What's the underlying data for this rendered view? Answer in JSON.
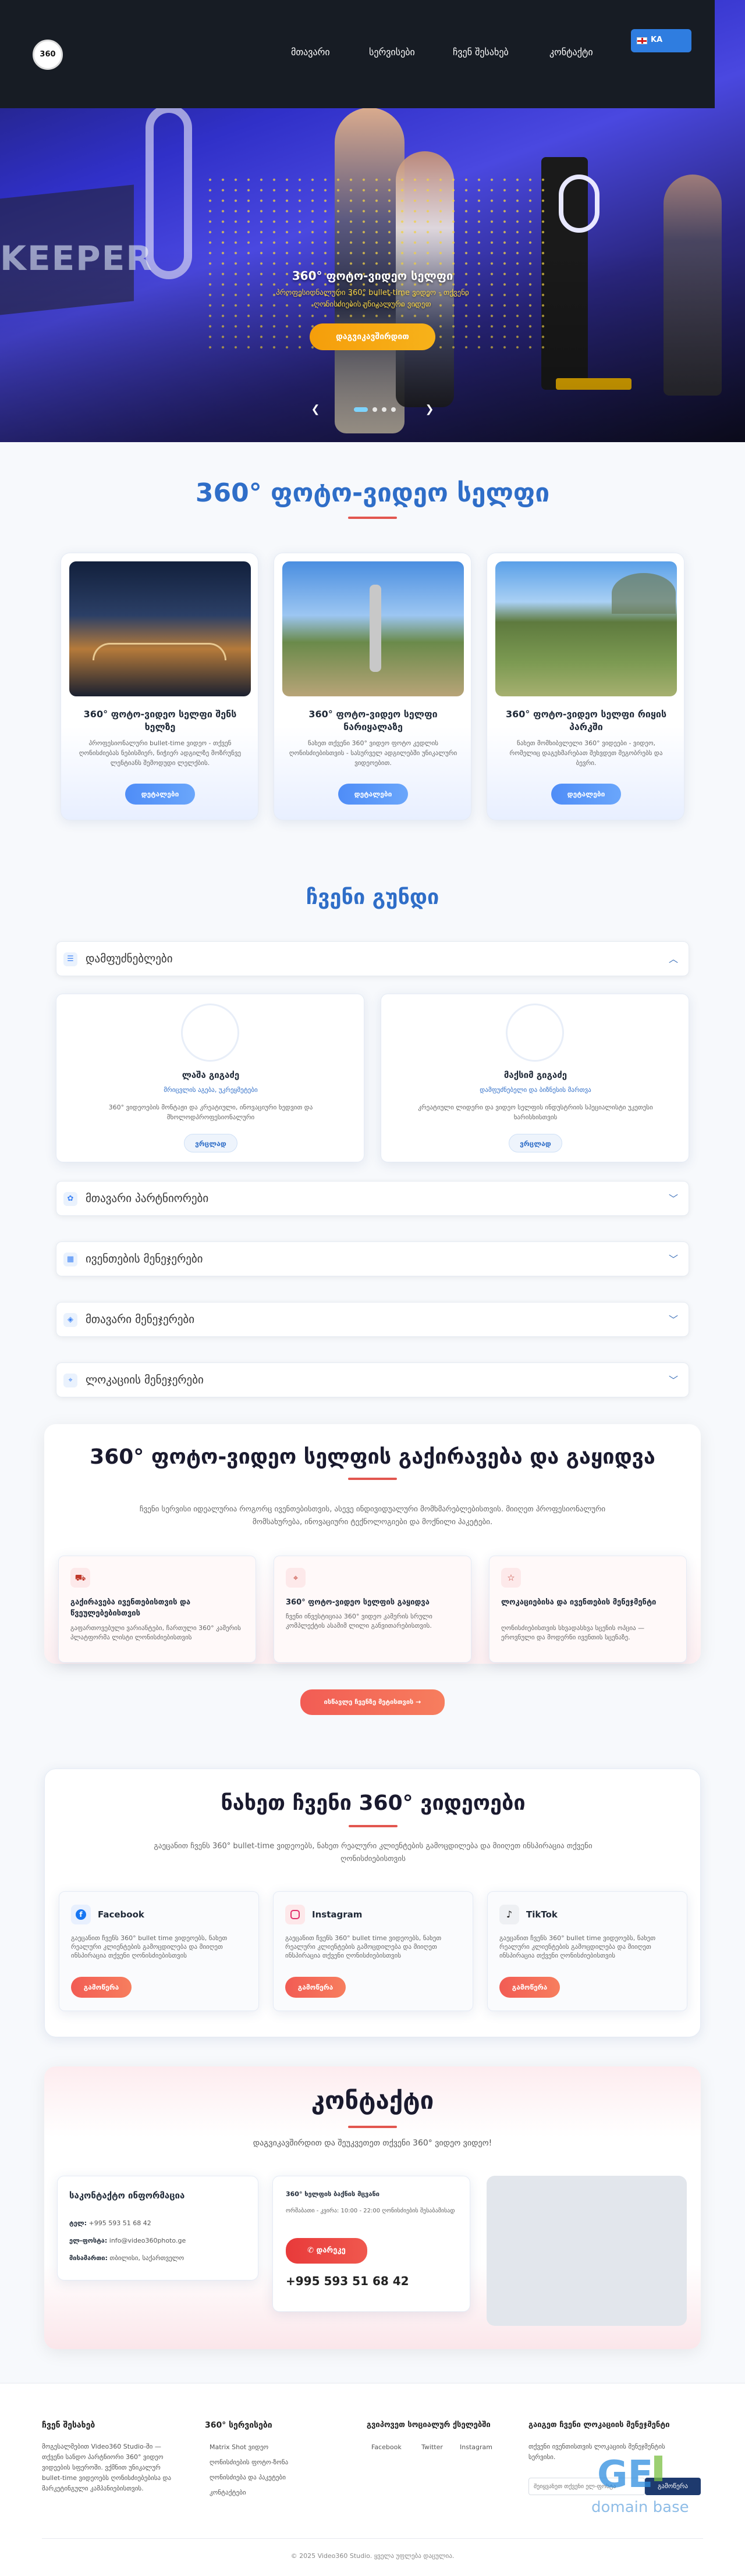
{
  "nav": {
    "logo_text": "360",
    "links": [
      "მთავარი",
      "სერვისები",
      "ჩვენ შესახებ",
      "კონტაქტი"
    ],
    "lang": "KA"
  },
  "hero": {
    "banner_text": "KEEPER",
    "title": "360° ფოტო-ვიდეო სელფი",
    "subtitle": "პროფესიონალური 360° bullet-time ვიდეო - თქვენი ღონისძიების უნიკალური ვიდეო",
    "cta": "დაგვიკავშირდით",
    "prev": "❮",
    "next": "❯"
  },
  "services": {
    "title": "360° ფოტო-ვიდეო სელფი",
    "cards": [
      {
        "title": "360° ფოტო-ვიდეო სელფი შენს ხელზე",
        "text": "პროფესიონალური bullet-time ვიდეო - თქვენ ღონისძიებას ნებისმიერ, ნიჭიერ ადგილზე მოზრუნვე ლენტიანს შემოდუდი ლელქბის.",
        "button": "დეტალები"
      },
      {
        "title": "360° ფოტო-ვიდეო სელფი ნარიყალაზე",
        "text": "ნახეთ თქვენი 360° ვიდეო ფოტო კედლის ღონისძიებისთვის - სასურველ ადგილებში უნიკალური ვიდეოებით.",
        "button": "დეტალები"
      },
      {
        "title": "360° ფოტო-ვიდეო სელფი რიყის პარკში",
        "text": "ნახეთ მომხიბვლელი 360° ვიდეები - ვიდეო, რომელიც დაგეხმარებათ შეხვდეთ მეგობრებს და ბევრი.",
        "button": "დეტალები"
      }
    ]
  },
  "team": {
    "title": "ჩვენი გუნდი",
    "founders_label": "დამფუძნებლები",
    "members": [
      {
        "name": "ლაშა გიგაძე",
        "role": "მრიცვლის აგება, უკრეყმეტები",
        "desc": "360° ვიდეოების მონტაჟი და კრეატიული, ინოვაციური ხედვით და მხოლოდპროფესიონალური",
        "button": "ვრცლად"
      },
      {
        "name": "მაქსიმ გიგაძე",
        "role": "დამფუძნებელი და ბიზნესის მართვა",
        "desc": "კრეატიული ლიდერი და ვიდეო სელფის ინდუსტრიის სპეციალისტი უკეთესი ხარისხისთვის",
        "button": "ვრცლად"
      }
    ],
    "sections": [
      "მთავარი პარტნიორები",
      "ივენთების მენეჯერები",
      "მთავარი მენეჯერები",
      "ლოკაციის მენეჯერები"
    ]
  },
  "rental": {
    "title": "360° ფოტო-ვიდეო სელფის გაქირავება და გაყიდვა",
    "description": "ჩვენი სერვისი იდეალურია როგორც ივენთებისთვის, ასევე ინდივიდუალური მომხმარებლებისთვის. მიიღეთ პროფესიონალური მომსახურება, ინოვაციური ტექნოლოგიები და მოქნილი პაკეტები.",
    "features": [
      {
        "title": "გაქირავება ივენთებისთვის და წვეულებებისთვის",
        "text": "გაფართოვებული ვარიანტები, ჩართული 360° კამერის პლატფორმა ლისტი ლონისძიებისთვის"
      },
      {
        "title": "360° ფოტო-ვიდეო სელფის გაყიდვა",
        "text": "ჩვენი ინვესტიციაა 360° ვიდეო კამერის სრული კომპლექტის ასამიმ ლილი განვითარებისთვის."
      },
      {
        "title": "ლოკაციებისა და ივენთების მენეჯმენტი",
        "text": "ღონისძიებისთვის სხვადასხვა სცენის ოპცია — ეროვნული და მოდერნი ივენთის სცენაზე."
      }
    ],
    "cta": "ისწავლე ჩვენზე მეტისთვის →"
  },
  "videos": {
    "title": "ნახეთ ჩვენი 360° ვიდეოები",
    "description": "გაეცანით ჩვენს 360° bullet-time ვიდეოებს, ნახეთ რეალური კლიენტების გამოცდილება და მიიღეთ ინსპირაცია თქვენი ღონისძიებისთვის",
    "platforms": [
      {
        "name": "Facebook",
        "text": "გაეცანით ჩვენს 360° bullet time ვიდეოებს, ნახეთ რეალური კლიენტების გამოცდილება და მიიღეთ ინსპირაცია თქვენი ღონისძიებისთვის",
        "button": "გამოწერა"
      },
      {
        "name": "Instagram",
        "text": "გაეცანით ჩვენს 360° bullet time ვიდეოებს, ნახეთ რეალური კლიენტების გამოცდილება და მიიღეთ ინსპირაცია თქვენი ღონისძიებისთვის",
        "button": "გამოწერა"
      },
      {
        "name": "TikTok",
        "text": "გაეცანით ჩვენს 360° bullet time ვიდეოებს, ნახეთ რეალური კლიენტების გამოცდილება და მიიღეთ ინსპირაცია თქვენი ღონისძიებისთვის",
        "button": "გამოწერა"
      }
    ]
  },
  "contact": {
    "title": "კონტაქტი",
    "subtitle": "დაგვიკავშირდით და შეუკვეთეთ თქვენი 360° ვიდეო ვიდეო!",
    "info_title": "საკონტაქტო ინფორმაცია",
    "phone_label": "ტელ:",
    "phone": "+995 593 51 68 42",
    "email_label": "ელ-ფოსტა:",
    "email": "info@video360photo.ge",
    "address_label": "მისამართი:",
    "address": "თბილისი, საქართველო",
    "box_title": "360° ხელფის ბაქნის მცვანი",
    "box_text": "ორშაბათი - კვირა: 10:00 - 22:00 ღონისძიების შესაბამისად",
    "call_button": "დარეკე",
    "big_phone": "+995 593 51 68 42"
  },
  "footer": {
    "col1_title": "ჩვენ შესახებ",
    "col1_text": "მოგესალმებით Video360 Studio-ში — თქვენი სანდო პარტნიორი 360° ვიდეო ვიდეების სფეროში. ვქმნით უნიკალურ bullet-time ვიდეოებს ღონისძიებებისა და მარკეტინგული კამპანიებისთვის.",
    "col2_title": "360° სერვისები",
    "col2_links": [
      "Matrix Shot ვიდეო",
      "ღონისძიების ფოტო-ზონა",
      "ღონისძიება და პაკეტები",
      "კონტაქტები"
    ],
    "col3_title": "გვიპოვეთ სოციალურ ქსელებში",
    "col3_links": [
      "Facebook",
      "Twitter",
      "Instagram"
    ],
    "col4_title": "გაიგეთ ჩვენი ლოკაციის მენეჯმენტი",
    "col4_text": "თქვენი ივენთისთვის ლოკაციის მენეჯმენტის სერვისი.",
    "input_placeholder": "შეიყვანეთ თქვენი ელ-ფოსტა",
    "subscribe": "გამოწერა",
    "copyright": "© 2025 Video360 Studio. ყველა უფლება დაცულია.",
    "watermark": "GE",
    "watermark_sub": "domain base"
  }
}
